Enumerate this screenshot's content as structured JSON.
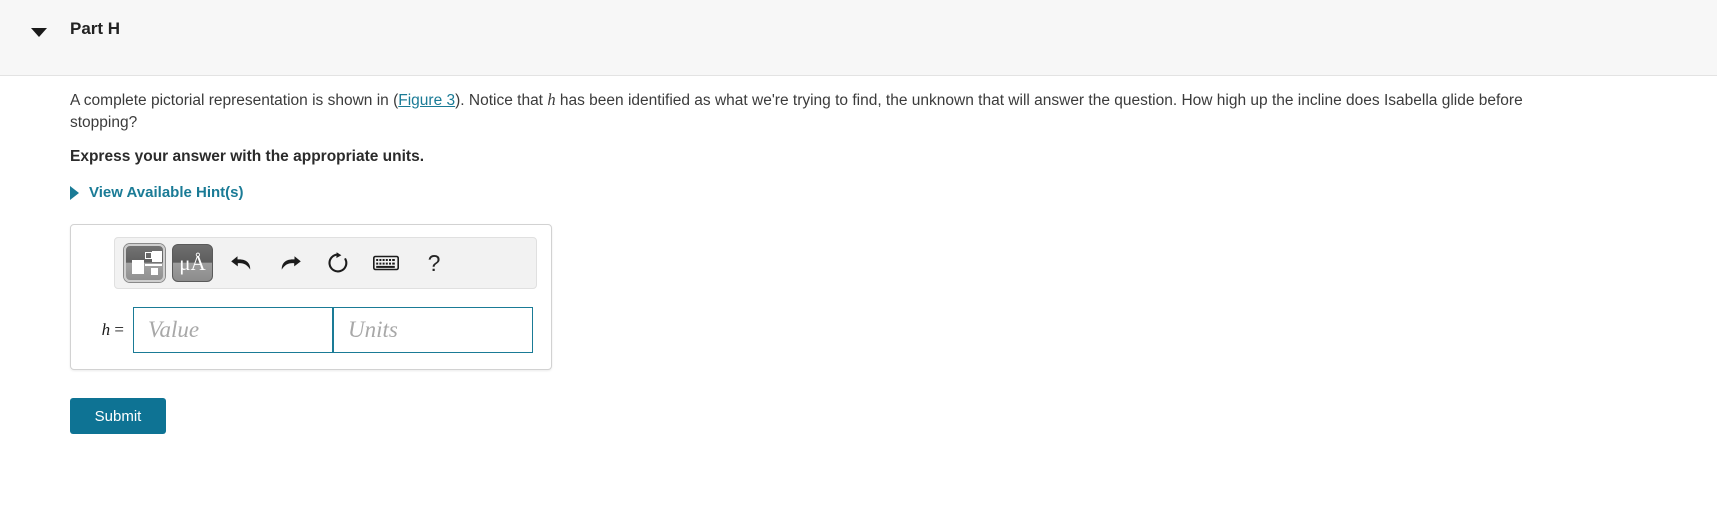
{
  "header": {
    "title": "Part H",
    "disclosure_state": "expanded"
  },
  "question": {
    "text_before_link": "A complete pictorial representation is shown in  (",
    "figure_link": "Figure 3",
    "text_after_link_1": "). Notice that ",
    "variable": "h",
    "text_after_link_2": " has been identified as what we're trying to find, the unknown that will answer the question. How high up the incline does Isabella glide before stopping?",
    "instruction": "Express your answer with the appropriate units."
  },
  "hints": {
    "label": "View Available Hint(s)"
  },
  "answer": {
    "toolbar": {
      "template_button": "math-template",
      "units_button": "μÅ",
      "undo_button": "undo",
      "redo_button": "redo",
      "reset_button": "reset",
      "keyboard_button": "keyboard",
      "help_button": "?"
    },
    "variable_label": "h",
    "equals_sign": "=",
    "value_placeholder": "Value",
    "units_placeholder": "Units",
    "value_current": "",
    "units_current": ""
  },
  "submit": {
    "label": "Submit"
  },
  "colors": {
    "accent": "#0e7394",
    "link": "#1a7b96",
    "header_bg": "#f7f7f7",
    "input_border": "#1a7b96"
  }
}
